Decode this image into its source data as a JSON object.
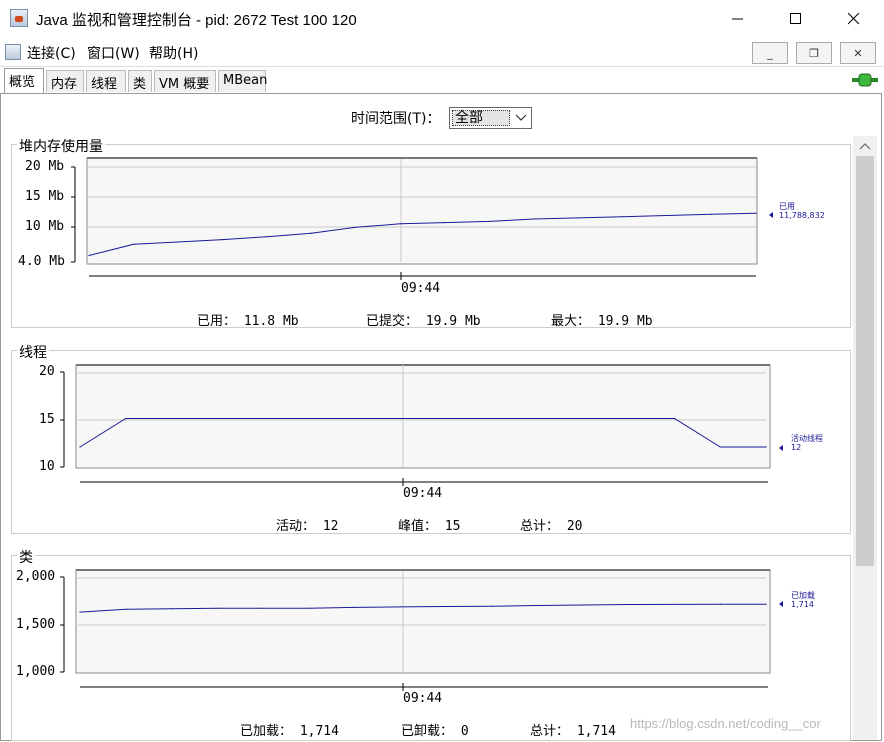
{
  "window": {
    "title": "Java 监视和管理控制台 - pid: 2672 Test 100 120"
  },
  "menubar": {
    "items": [
      "连接(C)",
      "窗口(W)",
      "帮助(H)"
    ]
  },
  "tabs": [
    "概览",
    "内存",
    "线程",
    "类",
    "VM 概要",
    "MBean"
  ],
  "active_tab": "概览",
  "time_range": {
    "label": "时间范围(T)：",
    "value": "全部"
  },
  "panels": {
    "heap": {
      "title": "堆内存使用量",
      "yticks": [
        "20 Mb",
        "15 Mb",
        "10 Mb",
        "4.0 Mb"
      ],
      "xtick": "09:44",
      "legend_name": "已用",
      "legend_value": "11,788,832",
      "stats": [
        "已用：  11.8  Mb",
        "已提交：  19.9  Mb",
        "最大：  19.9  Mb"
      ]
    },
    "threads": {
      "title": "线程",
      "yticks": [
        "20",
        "15",
        "10"
      ],
      "xtick": "09:44",
      "legend_name": "活动线程",
      "legend_value": "12",
      "stats": [
        "活动：  12",
        "峰值：  15",
        "总计：  20"
      ]
    },
    "classes": {
      "title": "类",
      "yticks": [
        "2,000",
        "1,500",
        "1,000"
      ],
      "xtick": "09:44",
      "legend_name": "已加载",
      "legend_value": "1,714",
      "stats": [
        "已加载：  1,714",
        "已卸载：  0",
        "总计：  1,714"
      ]
    }
  },
  "chart_data": [
    {
      "type": "line",
      "series": [
        {
          "name": "已用",
          "values": [
            4.6,
            6.5,
            6.9,
            7.3,
            7.8,
            8.4,
            9.4,
            10.0,
            10.2,
            10.4,
            10.8,
            11.0,
            11.2,
            11.4,
            11.6,
            11.8
          ]
        }
      ],
      "ylim": [
        4,
        20
      ],
      "color": "#1a1a99"
    },
    {
      "type": "line",
      "series": [
        {
          "name": "活动线程",
          "values": [
            12,
            15,
            15,
            15,
            15,
            15,
            15,
            15,
            15,
            15,
            15,
            15,
            15,
            15,
            12,
            12
          ]
        }
      ],
      "ylim": [
        10,
        20
      ],
      "color": "#1a1a99"
    },
    {
      "type": "line",
      "series": [
        {
          "name": "已加载",
          "values": [
            1630,
            1660,
            1665,
            1670,
            1670,
            1672,
            1680,
            1685,
            1690,
            1692,
            1700,
            1705,
            1710,
            1712,
            1714,
            1714
          ]
        }
      ],
      "ylim": [
        1000,
        2000
      ],
      "color": "#1a1a99"
    }
  ],
  "watermark": "https://blog.csdn.net/coding__cor"
}
